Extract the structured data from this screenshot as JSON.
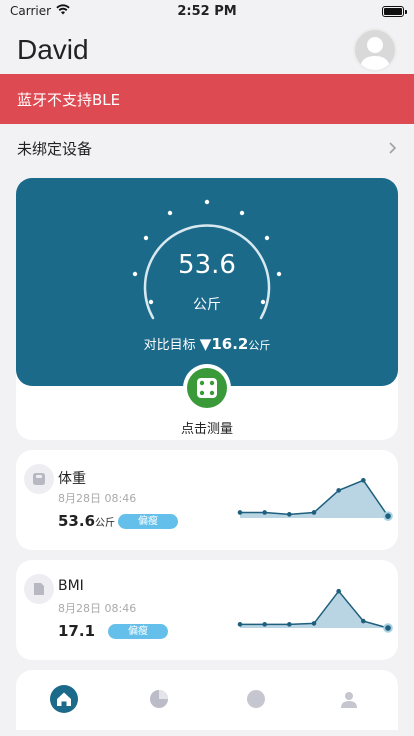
{
  "status_bar": {
    "carrier": "Carrier",
    "time": "2:52 PM"
  },
  "header": {
    "user_name": "David"
  },
  "ble_banner": {
    "text": "蓝牙不支持BLE"
  },
  "device_row": {
    "label": "未绑定设备"
  },
  "gauge": {
    "weight": "53.6",
    "unit": "公斤",
    "compare_label": "对比目标",
    "compare_arrow": "▼",
    "compare_value": "16.2",
    "compare_unit": "公斤"
  },
  "measure": {
    "label": "点击测量"
  },
  "metrics": [
    {
      "title": "体重",
      "date": "8月28日 08:46",
      "value": "53.6",
      "unit": "公斤",
      "badge": "偏瘦",
      "trend": [
        0.12,
        0.12,
        0.08,
        0.12,
        0.6,
        0.82,
        0.04
      ]
    },
    {
      "title": "BMI",
      "date": "8月28日 08:46",
      "value": "17.1",
      "unit": "",
      "badge": "偏瘦",
      "trend": [
        0.08,
        0.08,
        0.08,
        0.1,
        0.8,
        0.15,
        0.0
      ]
    }
  ],
  "tabs": [
    "home-icon",
    "pie-chart-icon",
    "trends-icon",
    "profile-icon"
  ],
  "colors": {
    "banner": "#de4a52",
    "gauge": "#1c6a8a",
    "accent": "#3a9a3a",
    "badge": "#64c0ea",
    "spark": "#1d5f7d"
  }
}
